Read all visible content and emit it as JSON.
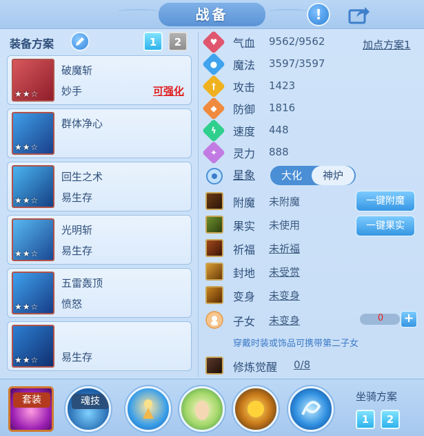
{
  "title": "战备",
  "left": {
    "scheme_label": "装备方案",
    "scheme_buttons": [
      "1",
      "2"
    ],
    "equipment": [
      {
        "name": "破魔斩",
        "sub": "妙手",
        "tag": "可强化",
        "stars": "★★☆"
      },
      {
        "name": "群体净心",
        "sub": "",
        "tag": "",
        "stars": "★★☆"
      },
      {
        "name": "回生之术",
        "sub": "易生存",
        "tag": "",
        "stars": "★★☆"
      },
      {
        "name": "光明斩",
        "sub": "易生存",
        "tag": "",
        "stars": "★★☆"
      },
      {
        "name": "五雷轰顶",
        "sub": "愤怒",
        "tag": "",
        "stars": "★★☆"
      },
      {
        "name": "",
        "sub": "易生存",
        "tag": "",
        "stars": "★★☆"
      }
    ]
  },
  "stats": {
    "plan_link": "加点方案1",
    "rows": [
      {
        "label": "气血",
        "value": "9562/9562",
        "icon": "heart-icon",
        "color": "#e0566e"
      },
      {
        "label": "魔法",
        "value": "3597/3597",
        "icon": "drop-icon",
        "color": "#3fa3ee"
      },
      {
        "label": "攻击",
        "value": "1423",
        "icon": "sword-icon",
        "color": "#f0b11e"
      },
      {
        "label": "防御",
        "value": "1816",
        "icon": "shield-icon",
        "color": "#f08a3f"
      },
      {
        "label": "速度",
        "value": "448",
        "icon": "lightning-icon",
        "color": "#2fcf8d"
      },
      {
        "label": "灵力",
        "value": "888",
        "icon": "sparkle-icon",
        "color": "#c27be3"
      }
    ],
    "xingxiang": {
      "label": "星象",
      "options": [
        "大化",
        "神炉"
      ]
    },
    "extras": [
      {
        "label": "附魔",
        "value": "未附魔",
        "underline": false,
        "button": "一键附魔"
      },
      {
        "label": "果实",
        "value": "未使用",
        "underline": false,
        "button": "一键果实"
      },
      {
        "label": "祈福",
        "value": "未祈福",
        "underline": true,
        "button": ""
      },
      {
        "label": "封地",
        "value": "未受赏",
        "underline": true,
        "button": ""
      },
      {
        "label": "变身",
        "value": "未变身",
        "underline": true,
        "button": ""
      },
      {
        "label": "子女",
        "value": "未变身",
        "underline": true,
        "button": ""
      }
    ],
    "child_counter": "0",
    "plus": "+",
    "note": "穿戴时装或饰品可携带第二子女",
    "awaken": {
      "label": "修炼觉醒",
      "value": "0/8"
    }
  },
  "bottom": {
    "tabs": [
      "套装",
      "魂技"
    ],
    "mount_label": "坐骑方案",
    "mount_buttons": [
      "1",
      "2"
    ]
  },
  "colors": {
    "accent": "#3596e3",
    "warning": "#e02020"
  }
}
